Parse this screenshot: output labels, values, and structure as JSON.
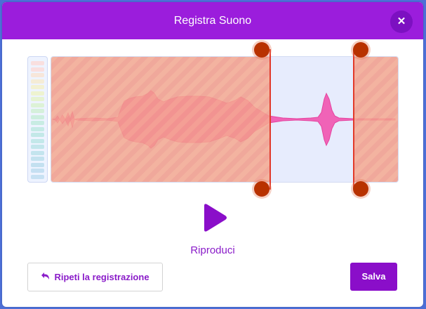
{
  "dialog": {
    "title": "Registra Suono",
    "close_icon": "close-icon"
  },
  "editor": {
    "trim": {
      "start": 0.631,
      "end": 0.875
    },
    "colors": {
      "trimmed_region": "#f29c8a",
      "kept_region": "#e7ecfd",
      "trim_handle": "#b83200",
      "trim_line": "#e13a2a",
      "waveform": "#f0609c"
    }
  },
  "playback": {
    "play_icon": "play-icon",
    "label": "Riproduci"
  },
  "footer": {
    "rerecord": {
      "icon": "undo-icon",
      "label": "Ripeti la registrazione"
    },
    "save": {
      "label": "Salva"
    }
  },
  "theme": {
    "accent": "#8a0ec9",
    "header": "#9b1ddc",
    "backdrop": "#4d6fd6"
  }
}
